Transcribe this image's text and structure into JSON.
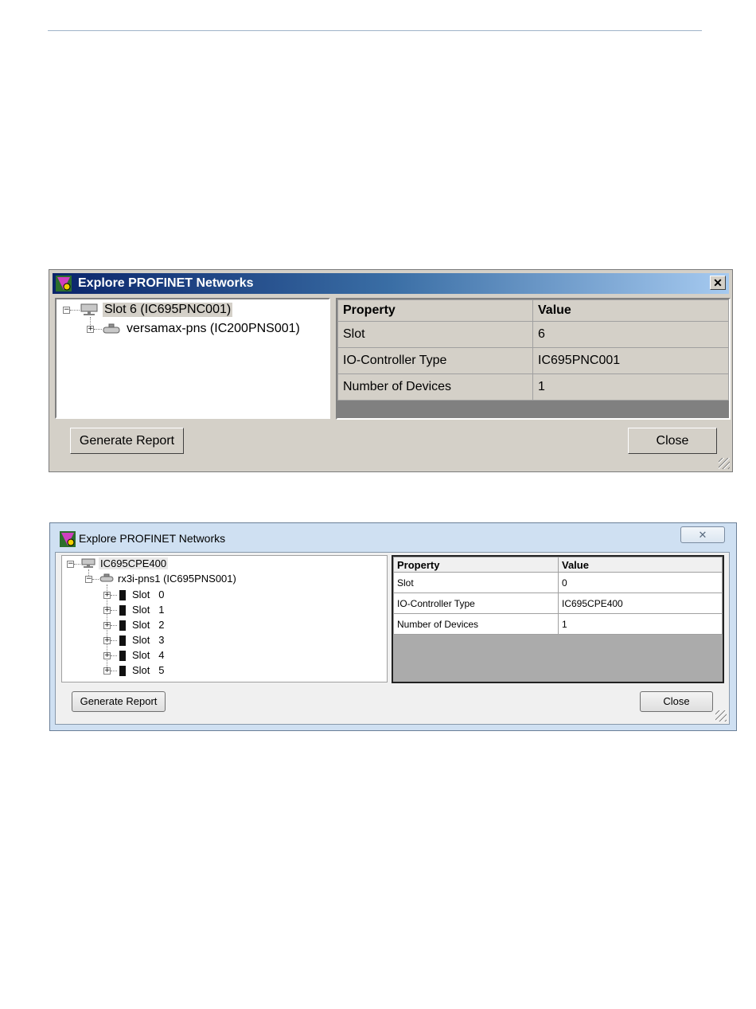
{
  "dialog1": {
    "title": "Explore PROFINET Networks",
    "close_glyph": "✕",
    "tree": [
      {
        "label": "Slot   6 (IC695PNC001)",
        "expander": "−",
        "icon": "controller-icon"
      },
      {
        "label": "versamax-pns (IC200PNS001)",
        "expander": "+",
        "icon": "device-icon"
      }
    ],
    "table": {
      "headers": [
        "Property",
        "Value"
      ],
      "rows": [
        [
          "Slot",
          "6"
        ],
        [
          "IO-Controller Type",
          "IC695PNC001"
        ],
        [
          "Number of Devices",
          "1"
        ]
      ]
    },
    "buttons": {
      "generate": "Generate Report",
      "close": "Close"
    }
  },
  "dialog2": {
    "title": "Explore PROFINET Networks",
    "close_glyph": "✕",
    "tree": {
      "root": {
        "label": "IC695CPE400",
        "expander": "−",
        "icon": "controller-icon"
      },
      "device": {
        "label": "rx3i-pns1 (IC695PNS001)",
        "expander": "−",
        "icon": "device-icon"
      },
      "slots": [
        {
          "label": "Slot",
          "num": "0"
        },
        {
          "label": "Slot",
          "num": "1"
        },
        {
          "label": "Slot",
          "num": "2"
        },
        {
          "label": "Slot",
          "num": "3"
        },
        {
          "label": "Slot",
          "num": "4"
        },
        {
          "label": "Slot",
          "num": "5"
        }
      ]
    },
    "table": {
      "headers": [
        "Property",
        "Value"
      ],
      "rows": [
        [
          "Slot",
          "0"
        ],
        [
          "IO-Controller Type",
          "IC695CPE400"
        ],
        [
          "Number of Devices",
          "1"
        ]
      ]
    },
    "buttons": {
      "generate": "Generate Report",
      "close": "Close"
    }
  }
}
